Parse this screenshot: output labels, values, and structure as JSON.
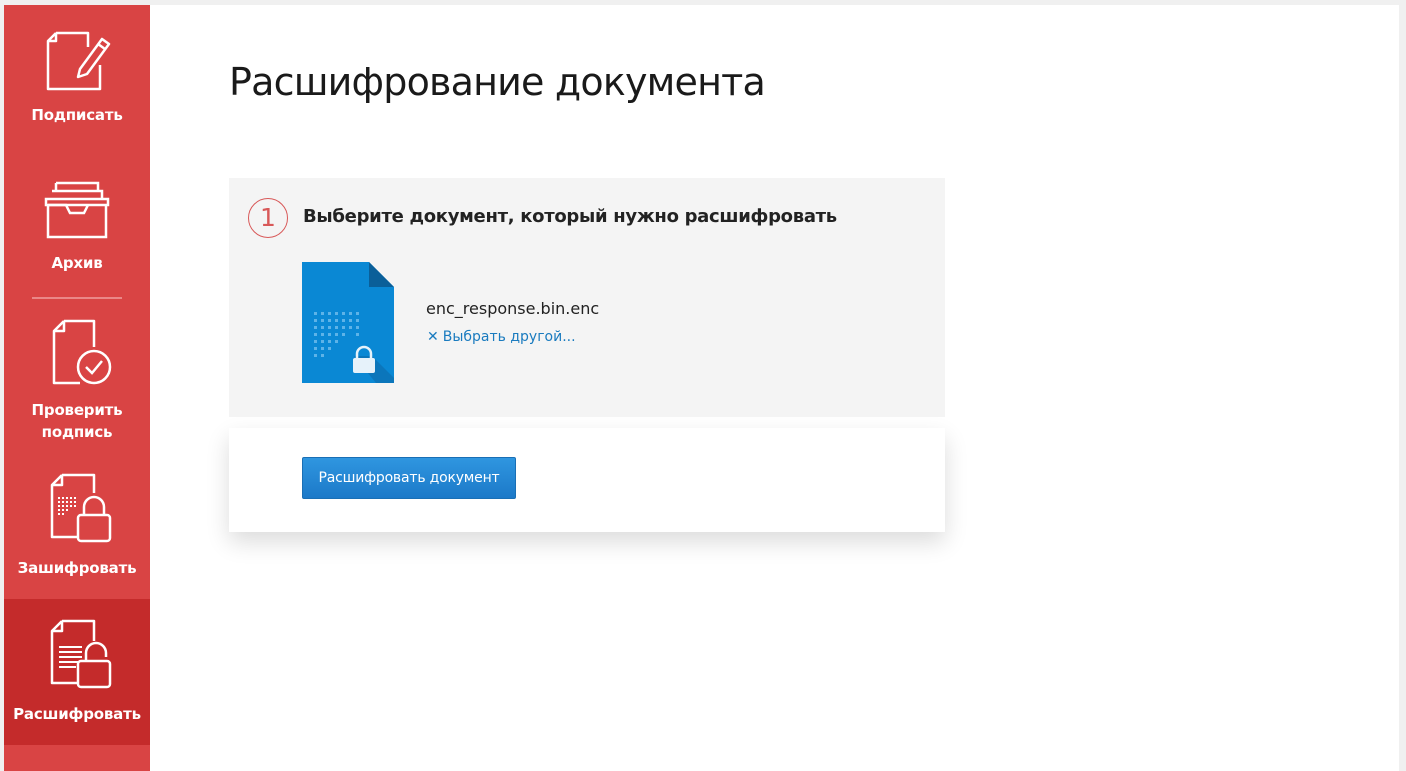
{
  "sidebar": {
    "items": [
      {
        "label": "Подписать",
        "icon": "sign-document-icon"
      },
      {
        "label": "Архив",
        "icon": "archive-tray-icon"
      },
      {
        "label": "Проверить подпись",
        "icon": "verify-signature-icon"
      },
      {
        "label": "Зашифровать",
        "icon": "encrypt-document-icon"
      },
      {
        "label": "Расшифровать",
        "icon": "decrypt-document-icon",
        "active": true
      }
    ]
  },
  "page": {
    "title": "Расшифрование документа"
  },
  "step1": {
    "number": "1",
    "title": "Выберите документ, который нужно расшифровать",
    "file_name": "enc_response.bin.enc",
    "choose_other_icon": "✕",
    "choose_other_label": "Выбрать другой..."
  },
  "actions": {
    "decrypt_button": "Расшифровать документ"
  },
  "colors": {
    "sidebar": "#d94444",
    "sidebar_active": "#c42b2b",
    "accent_blue": "#1c79c8",
    "file_icon_blue": "#0a88d4",
    "step_circle": "#d85858"
  }
}
